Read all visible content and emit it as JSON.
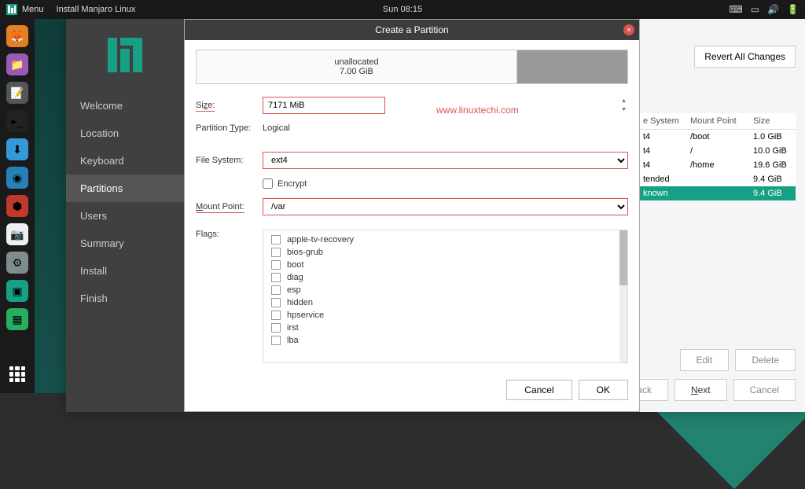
{
  "topbar": {
    "menu": "Menu",
    "title": "Install Manjaro Linux",
    "clock": "Sun 08:15"
  },
  "sidebar": {
    "items": [
      {
        "label": "Welcome"
      },
      {
        "label": "Location"
      },
      {
        "label": "Keyboard"
      },
      {
        "label": "Partitions"
      },
      {
        "label": "Users"
      },
      {
        "label": "Summary"
      },
      {
        "label": "Install"
      },
      {
        "label": "Finish"
      }
    ]
  },
  "buttons": {
    "revert": "Revert All Changes",
    "edit": "Edit",
    "delete": "Delete",
    "back": "Back",
    "next": "Next",
    "cancel": "Cancel"
  },
  "partTable": {
    "headers": {
      "fs": "e System",
      "mp": "Mount Point",
      "size": "Size"
    },
    "rows": [
      {
        "fs": "t4",
        "mp": "/boot",
        "size": "1.0 GiB"
      },
      {
        "fs": "t4",
        "mp": "/",
        "size": "10.0 GiB"
      },
      {
        "fs": "t4",
        "mp": "/home",
        "size": "19.6 GiB"
      },
      {
        "fs": "tended",
        "mp": "",
        "size": "9.4 GiB"
      },
      {
        "fs": "known",
        "mp": "",
        "size": "9.4 GiB"
      }
    ]
  },
  "dialog": {
    "title": "Create a Partition",
    "unalloc_label": "unallocated",
    "unalloc_size": "7.00 GiB",
    "labels": {
      "size": "Size:",
      "ptype": "Partition Type:",
      "fs": "File System:",
      "encrypt": "Encrypt",
      "mp": "Mount Point:",
      "flags": "Flags:"
    },
    "values": {
      "size": "7171 MiB",
      "ptype": "Logical",
      "fs": "ext4",
      "mp": "/var"
    },
    "flags": [
      "apple-tv-recovery",
      "bios-grub",
      "boot",
      "diag",
      "esp",
      "hidden",
      "hpservice",
      "irst",
      "lba"
    ],
    "btn_cancel": "Cancel",
    "btn_ok": "OK"
  },
  "watermark": "www.linuxtechi.com"
}
